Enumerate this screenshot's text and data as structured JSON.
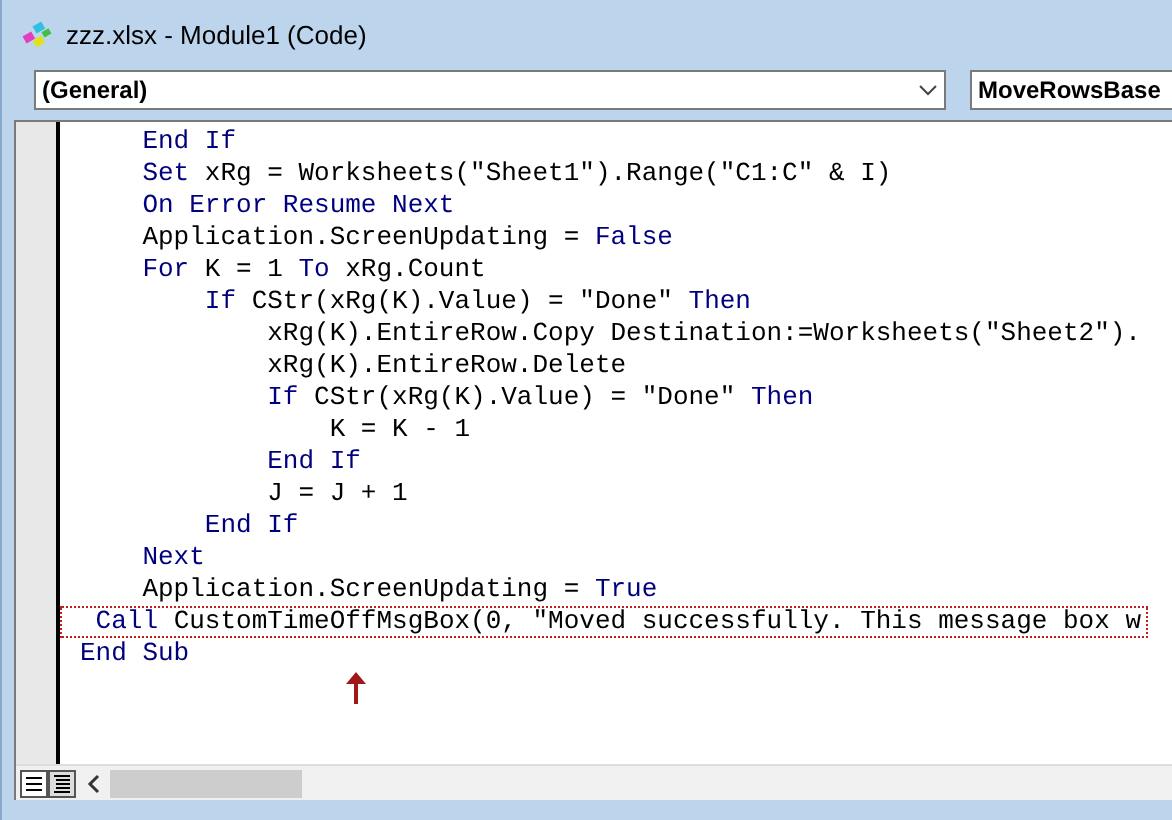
{
  "window": {
    "title": "zzz.xlsx - Module1 (Code)"
  },
  "object_combo": {
    "value": "(General)"
  },
  "procedure_combo": {
    "value": "MoveRowsBase"
  },
  "code_lines": [
    {
      "highlighted": false,
      "segments": [
        {
          "kind": "keyword",
          "text": "    End If"
        }
      ]
    },
    {
      "highlighted": false,
      "segments": [
        {
          "kind": "keyword",
          "text": "    Set"
        },
        {
          "kind": "text",
          "text": " xRg = Worksheets(\"Sheet1\").Range(\"C1:C\" & I)"
        }
      ]
    },
    {
      "highlighted": false,
      "segments": [
        {
          "kind": "keyword",
          "text": "    On Error Resume Next"
        }
      ]
    },
    {
      "highlighted": false,
      "segments": [
        {
          "kind": "text",
          "text": "    Application.ScreenUpdating = "
        },
        {
          "kind": "keyword",
          "text": "False"
        }
      ]
    },
    {
      "highlighted": false,
      "segments": [
        {
          "kind": "keyword",
          "text": "    For"
        },
        {
          "kind": "text",
          "text": " K = 1 "
        },
        {
          "kind": "keyword",
          "text": "To"
        },
        {
          "kind": "text",
          "text": " xRg.Count"
        }
      ]
    },
    {
      "highlighted": false,
      "segments": [
        {
          "kind": "keyword",
          "text": "        If"
        },
        {
          "kind": "text",
          "text": " CStr(xRg(K).Value) = \"Done\" "
        },
        {
          "kind": "keyword",
          "text": "Then"
        }
      ]
    },
    {
      "highlighted": false,
      "segments": [
        {
          "kind": "text",
          "text": "            xRg(K).EntireRow.Copy Destination:=Worksheets(\"Sheet2\")."
        }
      ]
    },
    {
      "highlighted": false,
      "segments": [
        {
          "kind": "text",
          "text": "            xRg(K).EntireRow.Delete"
        }
      ]
    },
    {
      "highlighted": false,
      "segments": [
        {
          "kind": "keyword",
          "text": "            If"
        },
        {
          "kind": "text",
          "text": " CStr(xRg(K).Value) = \"Done\" "
        },
        {
          "kind": "keyword",
          "text": "Then"
        }
      ]
    },
    {
      "highlighted": false,
      "segments": [
        {
          "kind": "text",
          "text": "                K = K - 1"
        }
      ]
    },
    {
      "highlighted": false,
      "segments": [
        {
          "kind": "keyword",
          "text": "            End If"
        }
      ]
    },
    {
      "highlighted": false,
      "segments": [
        {
          "kind": "text",
          "text": "            J = J + 1"
        }
      ]
    },
    {
      "highlighted": false,
      "segments": [
        {
          "kind": "keyword",
          "text": "        End If"
        }
      ]
    },
    {
      "highlighted": false,
      "segments": [
        {
          "kind": "keyword",
          "text": "    Next"
        }
      ]
    },
    {
      "highlighted": false,
      "segments": [
        {
          "kind": "text",
          "text": "    Application.ScreenUpdating = "
        },
        {
          "kind": "keyword",
          "text": "True"
        }
      ]
    },
    {
      "highlighted": true,
      "segments": [
        {
          "kind": "keyword",
          "text": " Call"
        },
        {
          "kind": "text",
          "text": " CustomTimeOffMsgBox(0, \"Moved successfully. This message box w"
        }
      ]
    },
    {
      "highlighted": false,
      "segments": [
        {
          "kind": "keyword",
          "text": "End Sub"
        }
      ]
    }
  ]
}
